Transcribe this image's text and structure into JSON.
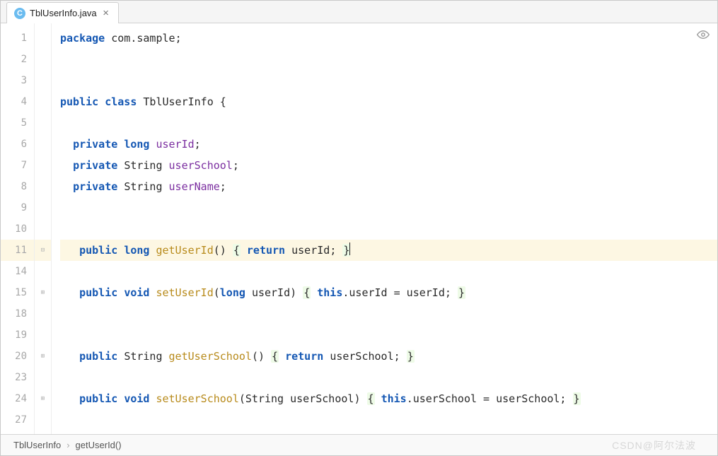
{
  "tab": {
    "icon_letter": "C",
    "filename": "TblUserInfo.java"
  },
  "gutter": {
    "lines": [
      "1",
      "2",
      "3",
      "4",
      "5",
      "6",
      "7",
      "8",
      "9",
      "10",
      "11",
      "14",
      "15",
      "18",
      "19",
      "20",
      "23",
      "24",
      "27"
    ],
    "highlighted": "11"
  },
  "fold": {
    "marks": {
      "11": "⊟",
      "15": "⊞",
      "20": "⊞",
      "24": "⊞"
    }
  },
  "tokens": {
    "package": "package",
    "public": "public",
    "class": "class",
    "private": "private",
    "long": "long",
    "void": "void",
    "return": "return",
    "this": "this",
    "String": "String"
  },
  "code": {
    "pkg_name": "com.sample",
    "class_name": "TblUserInfo",
    "field1": "userId",
    "field2": "userSchool",
    "field3": "userName",
    "m1_name": "getUserId",
    "m1_ret": "userId",
    "m2_name": "setUserId",
    "m2_param": "userId",
    "m2_body_lhs": ".userId = userId;",
    "m3_name": "getUserSchool",
    "m3_ret": "userSchool",
    "m4_name": "setUserSchool",
    "m4_param": "userSchool",
    "m4_body_lhs": ".userSchool = userSchool;"
  },
  "breadcrumb": {
    "class": "TblUserInfo",
    "method": "getUserId()"
  },
  "watermark": "CSDN@阿尔法波"
}
